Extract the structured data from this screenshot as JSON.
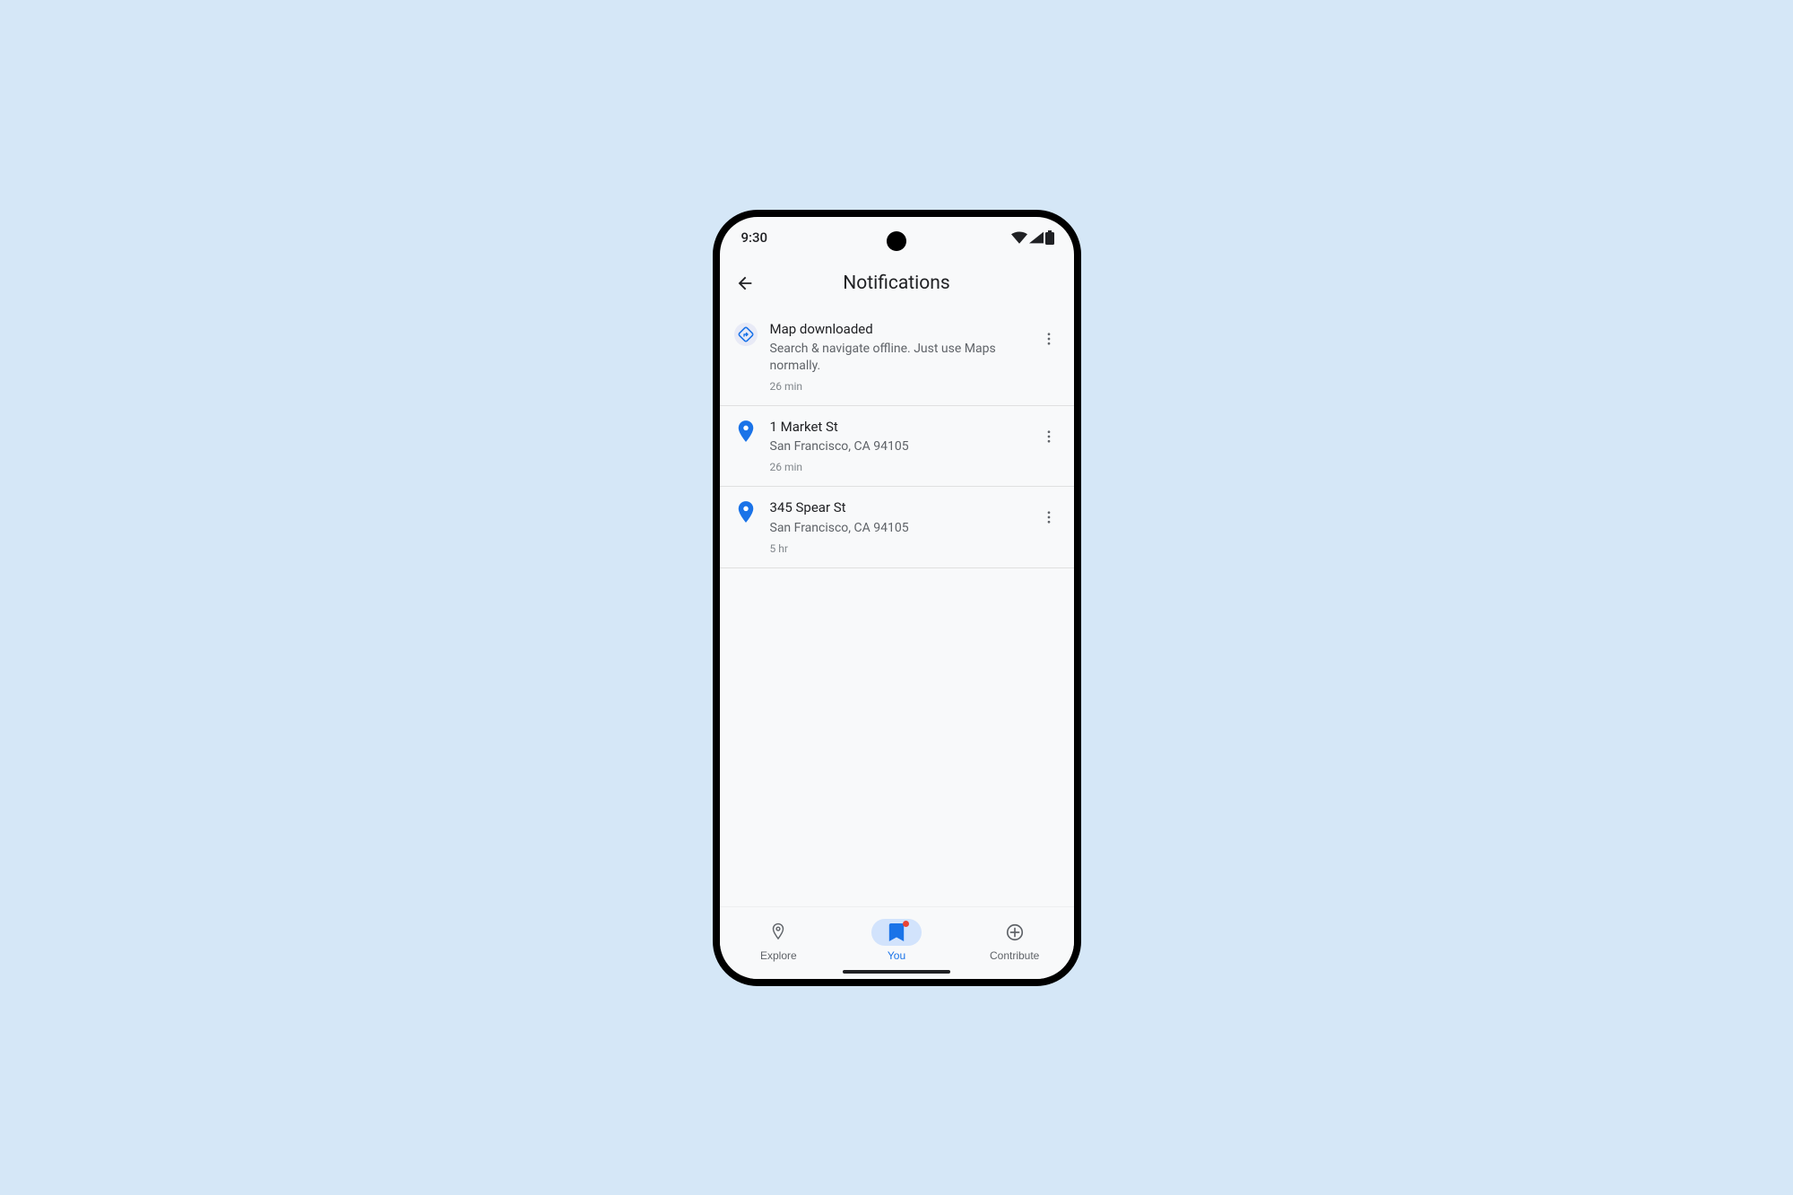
{
  "status_bar": {
    "time": "9:30"
  },
  "app_bar": {
    "title": "Notifications"
  },
  "notifications": [
    {
      "icon": "directions",
      "title": "Map downloaded",
      "subtitle": "Search & navigate offline. Just use Maps normally.",
      "time": "26 min"
    },
    {
      "icon": "pin",
      "title": "1 Market St",
      "subtitle": "San Francisco, CA 94105",
      "time": "26 min"
    },
    {
      "icon": "pin",
      "title": "345 Spear St",
      "subtitle": "San Francisco, CA 94105",
      "time": "5 hr"
    }
  ],
  "bottom_nav": {
    "items": [
      {
        "label": "Explore",
        "icon": "pin-outline",
        "active": false,
        "badge": false
      },
      {
        "label": "You",
        "icon": "bookmark",
        "active": true,
        "badge": true
      },
      {
        "label": "Contribute",
        "icon": "plus-circle",
        "active": false,
        "badge": false
      }
    ]
  },
  "colors": {
    "accent": "#1a73e8",
    "badge": "#ea4335"
  }
}
